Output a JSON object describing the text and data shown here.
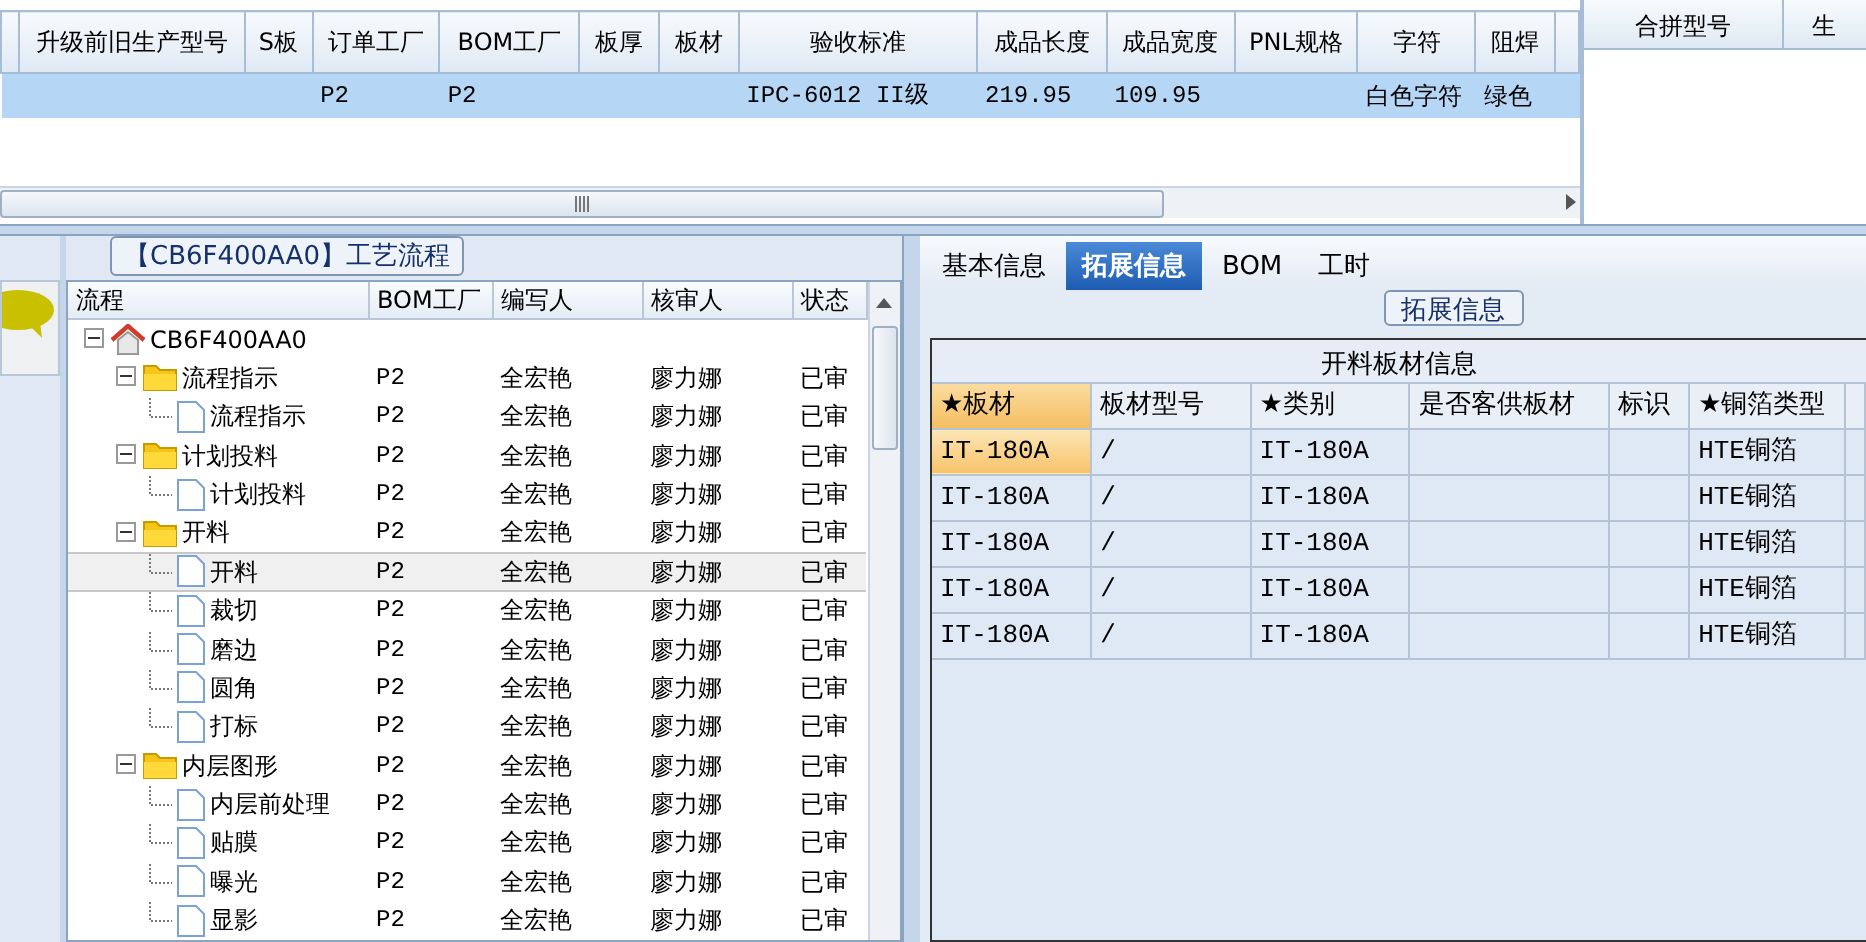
{
  "top_table": {
    "columns": [
      "升级前旧生产型号",
      "S板",
      "订单工厂",
      "BOM工厂",
      "板厚",
      "板材",
      "验收标准",
      "成品长度",
      "成品宽度",
      "PNL规格",
      "字符",
      "阻焊"
    ],
    "rows": [
      {
        "selected": true,
        "cells": [
          "",
          "",
          "P2",
          "P2",
          "",
          "",
          "IPC-6012 II级",
          "219.95",
          "109.95",
          "",
          "白色字符",
          "绿色"
        ]
      }
    ]
  },
  "merge_panel": {
    "columns": [
      "合拼型号",
      "生"
    ]
  },
  "process_panel": {
    "title": "【CB6F400AA0】工艺流程",
    "columns": [
      "流程",
      "BOM工厂",
      "编写人",
      "核审人",
      "状态"
    ],
    "tree": [
      {
        "name": "CB6F400AA0",
        "kind": "root",
        "expanded": true,
        "selected": false,
        "children": [
          {
            "name": "流程指示",
            "kind": "folder",
            "expanded": true,
            "selected": false,
            "bom": "P2",
            "writer": "全宏艳",
            "reviewer": "廖力娜",
            "status": "已审",
            "children": [
              {
                "name": "流程指示",
                "kind": "step",
                "selected": false,
                "bom": "P2",
                "writer": "全宏艳",
                "reviewer": "廖力娜",
                "status": "已审"
              }
            ]
          },
          {
            "name": "计划投料",
            "kind": "folder",
            "expanded": true,
            "selected": false,
            "bom": "P2",
            "writer": "全宏艳",
            "reviewer": "廖力娜",
            "status": "已审",
            "children": [
              {
                "name": "计划投料",
                "kind": "step",
                "selected": false,
                "bom": "P2",
                "writer": "全宏艳",
                "reviewer": "廖力娜",
                "status": "已审"
              }
            ]
          },
          {
            "name": "开料",
            "kind": "folder",
            "expanded": true,
            "selected": false,
            "bom": "P2",
            "writer": "全宏艳",
            "reviewer": "廖力娜",
            "status": "已审",
            "children": [
              {
                "name": "开料",
                "kind": "step",
                "selected": true,
                "bom": "P2",
                "writer": "全宏艳",
                "reviewer": "廖力娜",
                "status": "已审"
              },
              {
                "name": "裁切",
                "kind": "step",
                "selected": false,
                "bom": "P2",
                "writer": "全宏艳",
                "reviewer": "廖力娜",
                "status": "已审"
              },
              {
                "name": "磨边",
                "kind": "step",
                "selected": false,
                "bom": "P2",
                "writer": "全宏艳",
                "reviewer": "廖力娜",
                "status": "已审"
              },
              {
                "name": "圆角",
                "kind": "step",
                "selected": false,
                "bom": "P2",
                "writer": "全宏艳",
                "reviewer": "廖力娜",
                "status": "已审"
              },
              {
                "name": "打标",
                "kind": "step",
                "selected": false,
                "bom": "P2",
                "writer": "全宏艳",
                "reviewer": "廖力娜",
                "status": "已审"
              }
            ]
          },
          {
            "name": "内层图形",
            "kind": "folder",
            "expanded": true,
            "selected": false,
            "bom": "P2",
            "writer": "全宏艳",
            "reviewer": "廖力娜",
            "status": "已审",
            "children": [
              {
                "name": "内层前处理",
                "kind": "step",
                "selected": false,
                "bom": "P2",
                "writer": "全宏艳",
                "reviewer": "廖力娜",
                "status": "已审"
              },
              {
                "name": "贴膜",
                "kind": "step",
                "selected": false,
                "bom": "P2",
                "writer": "全宏艳",
                "reviewer": "廖力娜",
                "status": "已审"
              },
              {
                "name": "曝光",
                "kind": "step",
                "selected": false,
                "bom": "P2",
                "writer": "全宏艳",
                "reviewer": "廖力娜",
                "status": "已审"
              },
              {
                "name": "显影",
                "kind": "step",
                "selected": false,
                "bom": "P2",
                "writer": "全宏艳",
                "reviewer": "廖力娜",
                "status": "已审"
              }
            ]
          }
        ]
      }
    ]
  },
  "tabs": [
    {
      "label": "基本信息",
      "selected": false
    },
    {
      "label": "拓展信息",
      "selected": true
    },
    {
      "label": "BOM",
      "selected": false
    },
    {
      "label": "工时",
      "selected": false
    }
  ],
  "ext_group": {
    "title": "拓展信息",
    "table": {
      "title": "开料板材信息",
      "columns": [
        "★板材",
        "板材型号",
        "★类别",
        "是否客供板材",
        "标识",
        "★铜箔类型"
      ],
      "rows": [
        {
          "selected": true,
          "cells": [
            "IT-180A",
            "/",
            "IT-180A",
            "",
            "",
            "HTE铜箔"
          ]
        },
        {
          "selected": false,
          "cells": [
            "IT-180A",
            "/",
            "IT-180A",
            "",
            "",
            "HTE铜箔"
          ]
        },
        {
          "selected": false,
          "cells": [
            "IT-180A",
            "/",
            "IT-180A",
            "",
            "",
            "HTE铜箔"
          ]
        },
        {
          "selected": false,
          "cells": [
            "IT-180A",
            "/",
            "IT-180A",
            "",
            "",
            "HTE铜箔"
          ]
        },
        {
          "selected": false,
          "cells": [
            "IT-180A",
            "/",
            "IT-180A",
            "",
            "",
            "HTE铜箔"
          ]
        }
      ]
    }
  }
}
